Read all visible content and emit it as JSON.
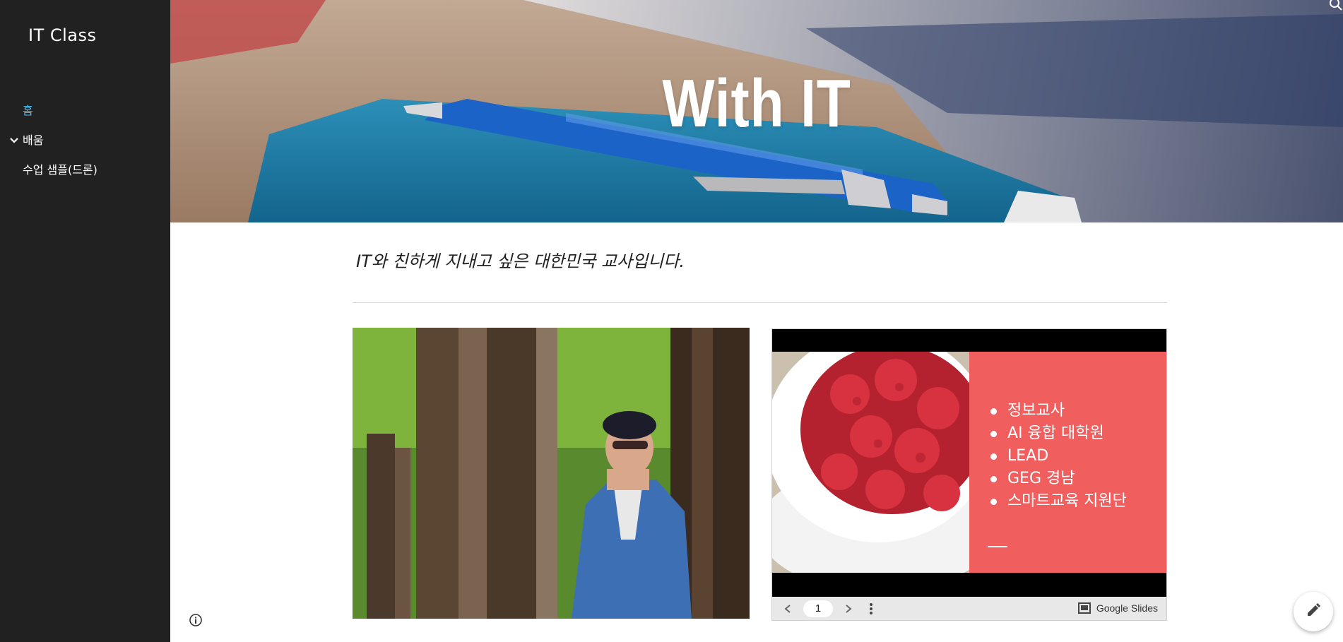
{
  "sidebar": {
    "site_title": "IT Class",
    "items": [
      {
        "label": "홈",
        "active": true
      },
      {
        "label": "배움",
        "expandable": true
      },
      {
        "label": "수업 샘플(드론)"
      }
    ]
  },
  "banner": {
    "title": "With IT"
  },
  "main": {
    "tagline": "IT와 친하게 지내고 싶은 대한민국 교사입니다."
  },
  "slides": {
    "bullets": [
      "정보교사",
      "AI 융합 대학원",
      "LEAD",
      "GEG 경남",
      "스마트교육 지원단"
    ],
    "page_number": "1",
    "brand": "Google Slides"
  },
  "icons": {
    "search": "search-icon",
    "chevron": "chevron-down-icon",
    "info": "info-icon",
    "edit": "pencil-icon",
    "prev": "chevron-left-icon",
    "next": "chevron-right-icon",
    "more": "more-vert-icon",
    "slides_logo": "google-slides-icon"
  },
  "colors": {
    "sidebar_bg": "#212121",
    "active_nav": "#4fc3f7",
    "slide_accent": "#f05e5e"
  }
}
